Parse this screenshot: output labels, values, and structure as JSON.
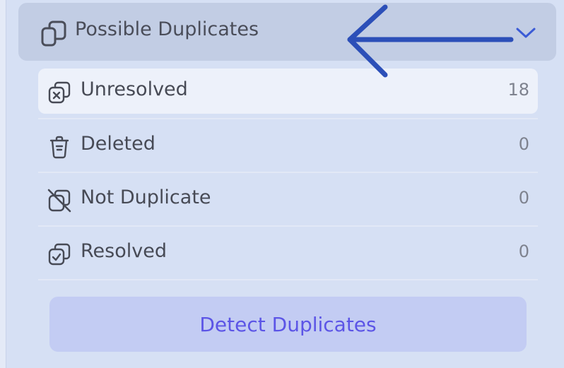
{
  "section": {
    "title": "Possible Duplicates",
    "header_icon": "copy-icon",
    "toggle_icon": "chevron-down-icon",
    "expanded": true
  },
  "annotation": {
    "type": "arrow",
    "direction": "left",
    "color": "#2c4fb8"
  },
  "items": [
    {
      "label": "Unresolved",
      "count": "18",
      "icon": "copy-x-icon",
      "selected": true
    },
    {
      "label": "Deleted",
      "count": "0",
      "icon": "trash-icon",
      "selected": false
    },
    {
      "label": "Not Duplicate",
      "count": "0",
      "icon": "copy-off-icon",
      "selected": false
    },
    {
      "label": "Resolved",
      "count": "0",
      "icon": "copy-check-icon",
      "selected": false
    }
  ],
  "actions": {
    "detect_label": "Detect Duplicates"
  },
  "colors": {
    "background": "#d6e0f4",
    "header_bg": "#c2cde4",
    "selected_bg": "#edf1fa",
    "button_bg": "#c3ccf3",
    "button_text": "#5c55e6"
  }
}
